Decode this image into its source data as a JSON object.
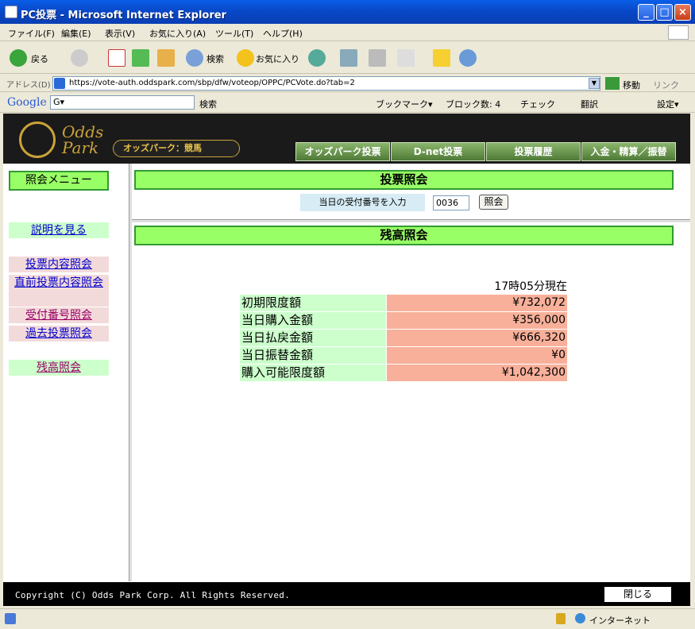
{
  "window": {
    "title": "PC投票 - Microsoft Internet Explorer",
    "minimize": "_",
    "maximize": "□",
    "close": "×"
  },
  "menubar": {
    "items": [
      "ファイル(F)",
      "編集(E)",
      "表示(V)",
      "お気に入り(A)",
      "ツール(T)",
      "ヘルプ(H)"
    ]
  },
  "toolbar": {
    "back": "戻る",
    "search": "検索",
    "favorites": "お気に入り"
  },
  "addressbar": {
    "label": "アドレス(D)",
    "url": "https://vote-auth.oddspark.com/sbp/dfw/voteop/OPPC/PCVote.do?tab=2",
    "go": "移動",
    "links": "リンク"
  },
  "googlebar": {
    "brand": "Google",
    "field": "G▾",
    "search": "検索",
    "bookmarks": "ブックマーク▾",
    "blocked": "ブロック数: 4",
    "check": "チェック",
    "translate": "翻訳",
    "settings": "設定▾"
  },
  "site": {
    "logo_text": "Odds\nPark",
    "logo_sub": "オッズパーク：競馬",
    "nav": [
      "オッズパーク投票",
      "D-net投票",
      "投票履歴",
      "入金・精算／振替"
    ]
  },
  "leftmenu": {
    "title": "照会メニュー",
    "help": "説明を見る",
    "items": [
      "投票内容照会",
      "直前投票内容照会",
      "受付番号照会",
      "過去投票照会",
      "残高照会"
    ]
  },
  "inquiry": {
    "title": "投票照会",
    "label": "当日の受付番号を入力",
    "value": "0036",
    "button": "照会"
  },
  "balance": {
    "title": "残高照会",
    "as_of": "17時05分現在",
    "rows": [
      {
        "label": "初期限度額",
        "value": "¥732,072"
      },
      {
        "label": "当日購入金額",
        "value": "¥356,000"
      },
      {
        "label": "当日払戻金額",
        "value": "¥666,320"
      },
      {
        "label": "当日振替金額",
        "value": "¥0"
      },
      {
        "label": "購入可能限度額",
        "value": "¥1,042,300"
      }
    ]
  },
  "footer": {
    "copyright": "Copyright (C) Odds Park Corp. All Rights Reserved.",
    "close": "閉じる"
  },
  "statusbar": {
    "zone": "インターネット"
  }
}
